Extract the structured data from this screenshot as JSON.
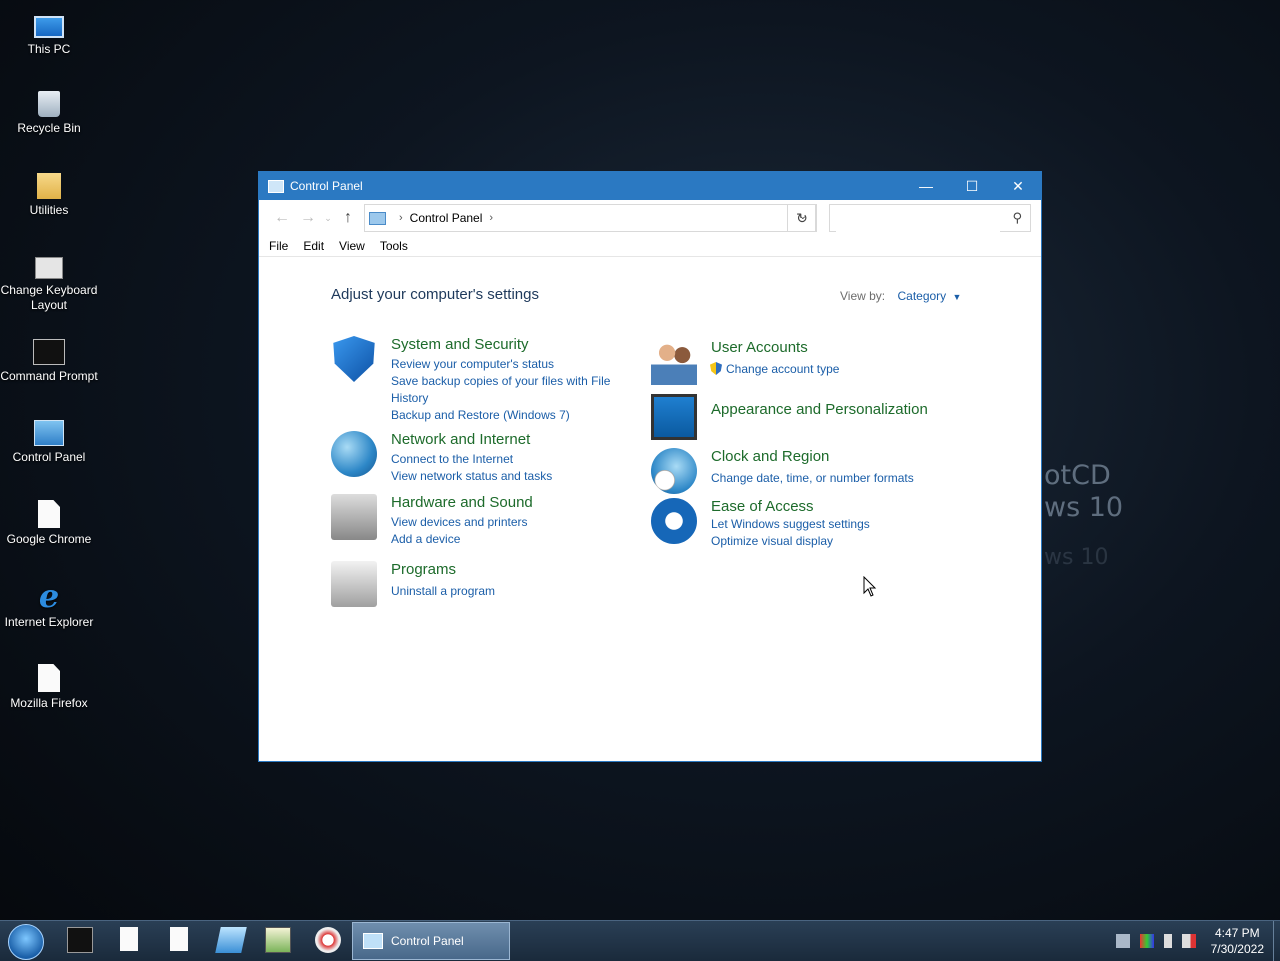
{
  "desktop": {
    "wallpaper_text": [
      "otCD",
      "ws 10",
      "ws 10"
    ],
    "icons": [
      {
        "label": "This PC",
        "icon": "computer-icon"
      },
      {
        "label": "Recycle Bin",
        "icon": "recycle-bin-icon"
      },
      {
        "label": "Utilities",
        "icon": "folder-icon"
      },
      {
        "label": "Change Keyboard Layout",
        "icon": "keyboard-icon"
      },
      {
        "label": "Command Prompt",
        "icon": "command-prompt-icon"
      },
      {
        "label": "Control Panel",
        "icon": "control-panel-icon"
      },
      {
        "label": "Google Chrome",
        "icon": "file-icon"
      },
      {
        "label": "Internet Explorer",
        "icon": "internet-explorer-icon"
      },
      {
        "label": "Mozilla Firefox",
        "icon": "file-icon"
      }
    ]
  },
  "window": {
    "title": "Control Panel",
    "controls": {
      "minimize": "—",
      "maximize": "☐",
      "close": "✕"
    },
    "address": {
      "crumb": "Control Panel",
      "sep": "›"
    },
    "search": {
      "placeholder": ""
    },
    "menu": [
      "File",
      "Edit",
      "View",
      "Tools"
    ],
    "heading": "Adjust your computer's settings",
    "view_by": {
      "label": "View by:",
      "value": "Category"
    },
    "categories": {
      "system": {
        "title": "System and Security",
        "links": [
          "Review your computer's status",
          "Save backup copies of your files with File History",
          "Backup and Restore (Windows 7)"
        ]
      },
      "network": {
        "title": "Network and Internet",
        "links": [
          "Connect to the Internet",
          "View network status and tasks"
        ]
      },
      "hardware": {
        "title": "Hardware and Sound",
        "links": [
          "View devices and printers",
          "Add a device"
        ]
      },
      "programs": {
        "title": "Programs",
        "links": [
          "Uninstall a program"
        ]
      },
      "users": {
        "title": "User Accounts",
        "links": [
          "Change account type"
        ]
      },
      "appearance": {
        "title": "Appearance and Personalization",
        "links": []
      },
      "clock": {
        "title": "Clock and Region",
        "links": [
          "Change date, time, or number formats"
        ]
      },
      "ease": {
        "title": "Ease of Access",
        "links": [
          "Let Windows suggest settings",
          "Optimize visual display"
        ]
      }
    }
  },
  "taskbar": {
    "active_window": "Control Panel",
    "time": "4:47 PM",
    "date": "7/30/2022"
  }
}
